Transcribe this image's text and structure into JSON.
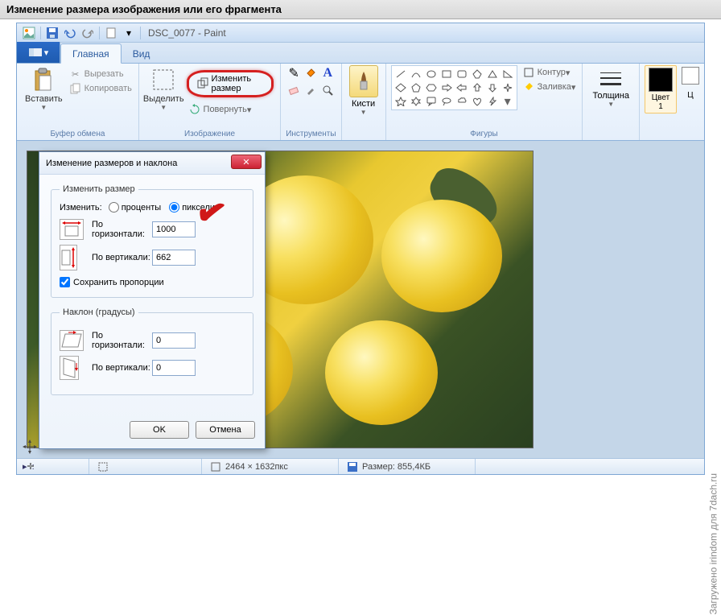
{
  "page_title": "Изменение размера изображения или его фрагмента",
  "window": {
    "doc_title": "DSC_0077 - Paint"
  },
  "tabs": {
    "home": "Главная",
    "view": "Вид"
  },
  "groups": {
    "clipboard": "Буфер обмена",
    "image": "Изображение",
    "tools": "Инструменты",
    "shapes": "Фигуры"
  },
  "clipboard": {
    "paste": "Вставить",
    "cut": "Вырезать",
    "copy": "Копировать"
  },
  "image": {
    "select": "Выделить",
    "resize": "Изменить размер",
    "rotate": "Повернуть"
  },
  "brushes": "Кисти",
  "shapes": {
    "outline": "Контур",
    "fill": "Заливка"
  },
  "thickness": "Толщина",
  "color1": {
    "label": "Цвет 1"
  },
  "color2_partial": "Ц",
  "status": {
    "dims_label": "2464 × 1632пкс",
    "size_label": "Размер: 855,4КБ"
  },
  "dialog": {
    "title": "Изменение размеров и наклона",
    "resize_legend": "Изменить размер",
    "change_label": "Изменить:",
    "percent": "проценты",
    "pixels": "пиксели",
    "horizontal": "По горизонтали:",
    "vertical": "По вертикали:",
    "h_value": "1000",
    "v_value": "662",
    "keep_aspect": "Сохранить пропорции",
    "skew_legend": "Наклон (градусы)",
    "skew_h": "0",
    "skew_v": "0",
    "ok": "OK",
    "cancel": "Отмена"
  },
  "watermark": "Загружено irindom для 7dach.ru"
}
